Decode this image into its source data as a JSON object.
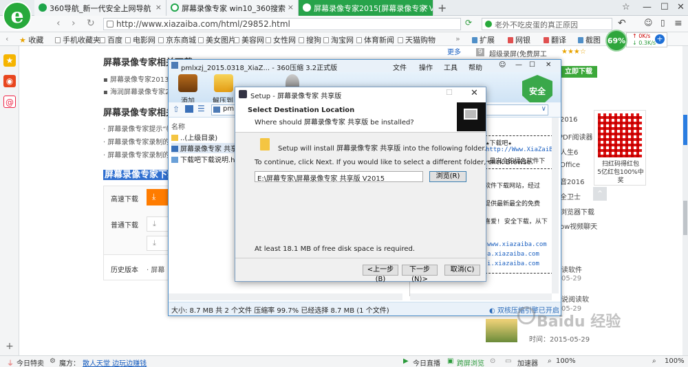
{
  "tabs": [
    {
      "label": "360导航_新一代安全上网导航",
      "icon_color": "#1ea54a"
    },
    {
      "label": "屏幕录像专家 win10_360搜索",
      "icon_color": "#1ea54a"
    },
    {
      "label": "屏幕录像专家2015[屏幕录像专家 V201",
      "icon_color": "#ffffff",
      "active": true
    }
  ],
  "new_tab": "+",
  "address": {
    "url": "http://www.xiazaiba.com/html/29852.html"
  },
  "search": {
    "placeholder": "老外不吃皮蛋的真正原因"
  },
  "bookmarks": [
    "收藏",
    "手机收藏夹",
    "百度",
    "电影网",
    "京东商城",
    "美女图片",
    "美容网",
    "女性网",
    "搜狗",
    "淘宝网",
    "体育新闻",
    "天猫购物"
  ],
  "bookmark_right": [
    "扩展",
    "网银",
    "翻译",
    "截图"
  ],
  "speed": {
    "percent": "69%",
    "up": "0K/s",
    "down": "0.3K/s"
  },
  "page": {
    "section1": "屏幕录像专家相关下载",
    "items1": [
      "屏幕录像专家2013(",
      "海润屏幕录像专家20"
    ],
    "section2": "屏幕录像专家相关文",
    "items2": [
      "屏幕录像专家提示“帧",
      "屏幕录像专家录制的视",
      "屏幕录像专家录制的视"
    ],
    "dl_heading": "屏幕录像专家下载",
    "dl_fast": "高速下载",
    "dl_normal": "普通下载",
    "dl_history": "历史版本",
    "dl_history_val": "· 屏幕",
    "more": "更多",
    "right_items": [
      {
        "num": "9",
        "text": "超级录屏(免费屏工"
      },
      {
        "text": "立即下载"
      },
      {
        "text": "2016"
      },
      {
        "text": "PDF阅读器"
      },
      {
        "text": "人生6"
      },
      {
        "text": "Office"
      },
      {
        "text": "音2016"
      },
      {
        "text": "全卫士"
      },
      {
        "text": "浏览器下载"
      },
      {
        "text": "ow视频聊天"
      },
      {
        "text": "读软件"
      },
      {
        "text": "05-29"
      },
      {
        "text": "说阅读软"
      },
      {
        "text": "05-29"
      },
      {
        "text": "时间：2015-05-29"
      }
    ],
    "qr_text": [
      "扫红码得红包",
      "5亿红包100%中奖"
    ]
  },
  "zip": {
    "title": "pmlxzj_2015.0318_XiaZ... - 360压缩 3.2正式版",
    "menu": [
      "文件",
      "操作",
      "工具",
      "帮助"
    ],
    "toolbar": [
      "添加",
      "解压到"
    ],
    "shield": "安全",
    "col_name": "名称",
    "rows": [
      "..(上级目录)",
      "屏幕录像专家 共享版",
      "下载吧下载说明.htm"
    ],
    "preview_lines": [
      "★下载吧★",
      "http://Www.XiaZaiBa",
      "→最安全的绿色软件下",
      "软件下载网站，经过",
      "提供最新最全的免费",
      "喜爱! 安全下载，从下",
      "www.xiazaiba.com",
      "a.xiazaiba.com",
      "i.xiazaiba.com"
    ],
    "status": "大小: 8.7 MB 共 2 个文件 压缩率 99.7% 已经选择 8.7 MB (1 个文件)",
    "status_right": "双核压缩引擎已开启"
  },
  "setup": {
    "title": "Setup - 屏幕录像专家 共享版",
    "heading": "Select Destination Location",
    "subheading": "Where should 屏幕录像专家 共享版 be installed?",
    "install_msg": "Setup will install 屏幕录像专家 共享版 into the following folder.",
    "continue_msg": "To continue, click Next. If you would like to select a different folder, click Browse.",
    "path": "E:\\屏幕专家\\屏幕录像专家 共享版 V2015",
    "browse": "浏览(R)",
    "space": "At least 18.1 MB of free disk space is required.",
    "back": "<上一步(B)",
    "next": "下一步(N)>",
    "cancel": "取消(C)"
  },
  "statusbar": [
    "今日特卖",
    "魔方：",
    "散人天堂 边玩边赚钱",
    "今日直播",
    "跨屏浏览",
    "加速器",
    "100%",
    "100%"
  ],
  "watermark": "Baidu 经验"
}
